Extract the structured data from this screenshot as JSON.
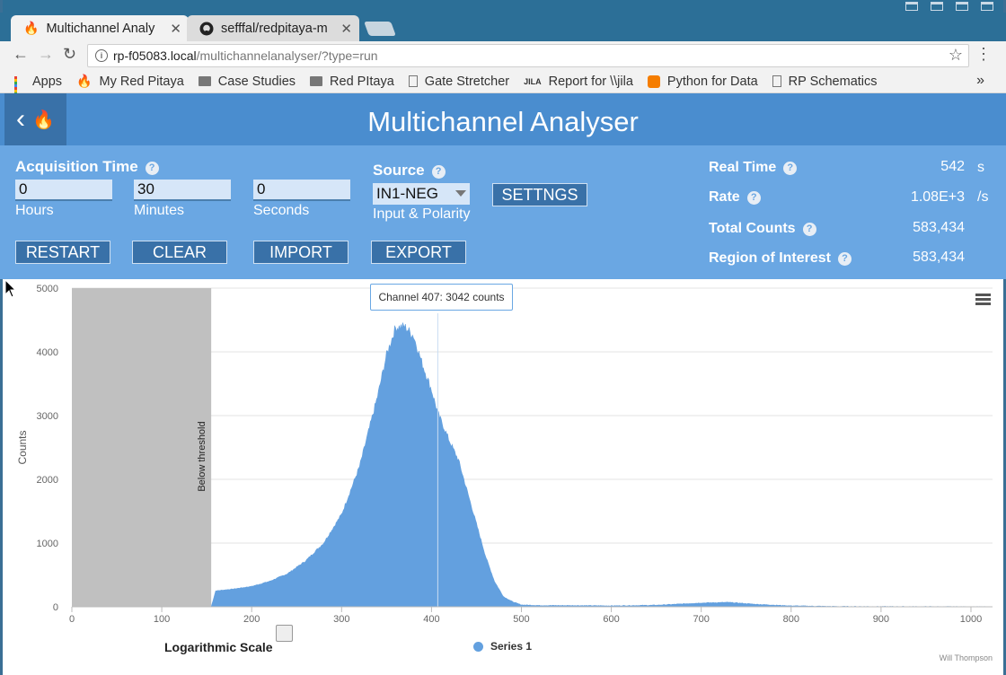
{
  "browser": {
    "tabs": [
      {
        "title": "Multichannel Analy",
        "icon": "red-pitaya-flame-icon",
        "active": true
      },
      {
        "title": "sefffal/redpitaya-m",
        "icon": "github-icon",
        "active": false
      }
    ],
    "url_host": "rp-f05083.local",
    "url_path": "/multichannelanalyser/?type=run",
    "bookmarks": [
      {
        "label": "Apps",
        "icon": "apps-grid-icon"
      },
      {
        "label": "My Red Pitaya",
        "icon": "red-pitaya-flame-icon"
      },
      {
        "label": "Case Studies",
        "icon": "folder-icon"
      },
      {
        "label": "Red PItaya",
        "icon": "folder-icon"
      },
      {
        "label": "Gate Stretcher",
        "icon": "page-icon"
      },
      {
        "label": "Report for \\\\jila",
        "icon": "jila-icon"
      },
      {
        "label": "Python for Data",
        "icon": "blogger-icon"
      },
      {
        "label": "RP Schematics",
        "icon": "page-icon"
      }
    ],
    "bookmarks_more": "»"
  },
  "app": {
    "title": "Multichannel Analyser",
    "acquisition_label": "Acquisition Time",
    "hours_value": "0",
    "hours_label": "Hours",
    "minutes_value": "30",
    "minutes_label": "Minutes",
    "seconds_value": "0",
    "seconds_label": "Seconds",
    "source_label": "Source",
    "source_value": "IN1-NEG",
    "source_sublabel": "Input & Polarity",
    "settings_button": "SETTNGS",
    "restart_button": "RESTART",
    "clear_button": "CLEAR",
    "import_button": "IMPORT",
    "export_button": "EXPORT",
    "help_glyph": "?",
    "stats": {
      "real_time_label": "Real Time",
      "real_time_value": "542",
      "real_time_unit": "s",
      "rate_label": "Rate",
      "rate_value": "1.08E+3",
      "rate_unit": "/s",
      "total_counts_label": "Total Counts",
      "total_counts_value": "583,434",
      "roi_label": "Region of Interest",
      "roi_value": "583,434"
    },
    "log_scale_label": "Logarithmic Scale",
    "log_scale_checked": false,
    "credit": "Will Thompson"
  },
  "chart_data": {
    "type": "area",
    "title": "",
    "xlabel": "",
    "ylabel": "Counts",
    "xlim": [
      0,
      1024
    ],
    "ylim": [
      0,
      5000
    ],
    "xticks": [
      0,
      100,
      200,
      300,
      400,
      500,
      600,
      700,
      800,
      900,
      1000
    ],
    "yticks": [
      0,
      1000,
      2000,
      3000,
      4000,
      5000
    ],
    "grid": true,
    "legend": "bottom-center",
    "threshold_band": {
      "x_from": 0,
      "x_to": 155,
      "label": "Below threshold",
      "color": "#c0c0c0"
    },
    "tooltip": "Channel 407: 3042 counts",
    "crosshair_x": 407,
    "series": [
      {
        "name": "Series 1",
        "color": "#63a0df",
        "x": [
          155,
          160,
          180,
          200,
          220,
          240,
          260,
          280,
          300,
          320,
          340,
          350,
          360,
          370,
          380,
          390,
          400,
          407,
          420,
          430,
          440,
          450,
          460,
          470,
          480,
          490,
          500,
          520,
          560,
          600,
          650,
          700,
          730,
          760,
          800,
          850,
          1024
        ],
        "values": [
          0,
          250,
          280,
          320,
          400,
          520,
          720,
          1000,
          1450,
          2200,
          3300,
          3950,
          4380,
          4400,
          4250,
          3800,
          3400,
          3042,
          2600,
          2300,
          1800,
          1300,
          800,
          400,
          160,
          80,
          30,
          20,
          20,
          15,
          25,
          60,
          70,
          40,
          15,
          5,
          0
        ]
      }
    ]
  }
}
